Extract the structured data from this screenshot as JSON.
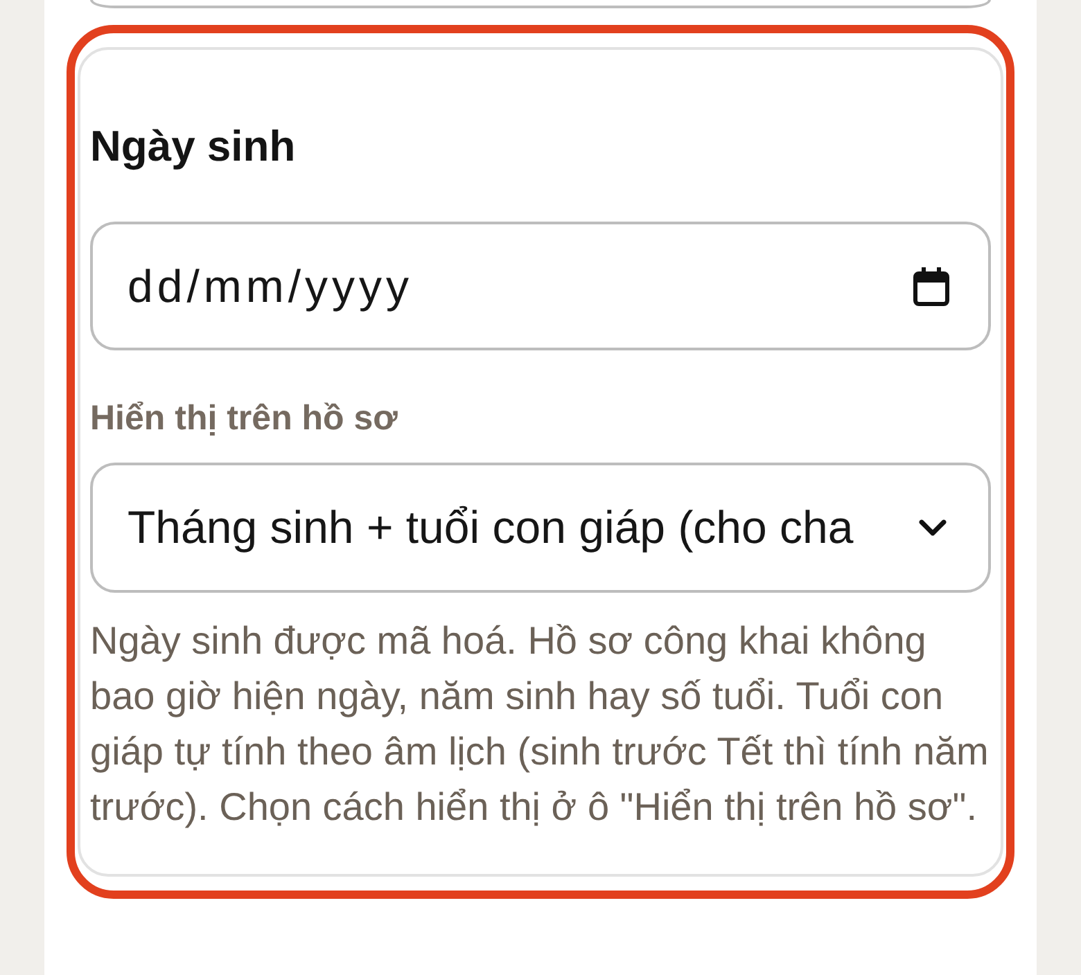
{
  "section": {
    "highlighted": true,
    "title": "Ngày sinh",
    "date_field": {
      "placeholder": "dd/mm/yyyy"
    },
    "display_label": "Hiển thị trên hồ sơ",
    "display_select": {
      "value": "Tháng sinh + tuổi con giáp (cho cha"
    },
    "help_text": "Ngày sinh được mã hoá. Hồ sơ công khai không bao giờ hiện ngày, năm sinh hay số tuổi. Tuổi con giáp tự tính theo âm lịch (sinh trước Tết thì tính năm trước). Chọn cách hiển thị ở ô \"Hiển thị trên hồ sơ\"."
  }
}
